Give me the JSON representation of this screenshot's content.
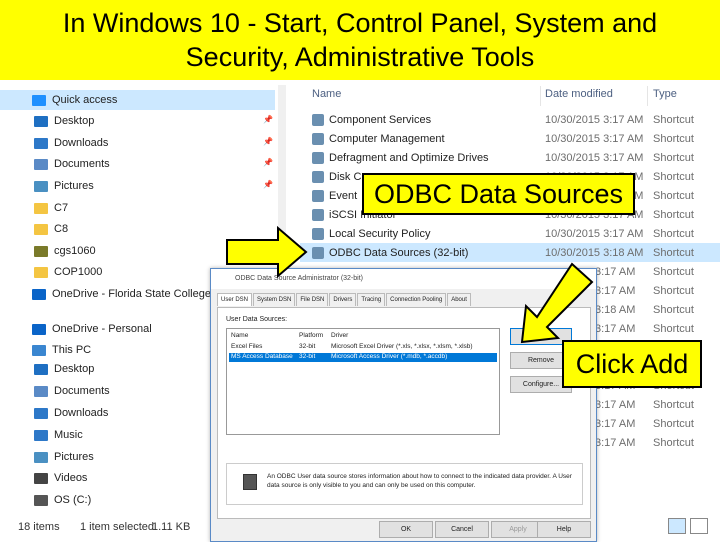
{
  "slide": {
    "title_line1": "In Windows 10 - Start, Control Panel, System and",
    "title_line2": "Security, Administrative Tools"
  },
  "explorer": {
    "nav": [
      {
        "label": "Quick access",
        "icon": "star-icon",
        "color": "#1e90ff"
      },
      {
        "label": "Desktop",
        "icon": "desktop-icon",
        "color": "#1e6fc2",
        "pinned": true
      },
      {
        "label": "Downloads",
        "icon": "download-icon",
        "color": "#2d78c8",
        "pinned": true
      },
      {
        "label": "Documents",
        "icon": "documents-icon",
        "color": "#5a8ac6",
        "pinned": true
      },
      {
        "label": "Pictures",
        "icon": "pictures-icon",
        "color": "#4a90c2",
        "pinned": true
      },
      {
        "label": "C7",
        "icon": "folder-icon",
        "color": "#f4c542"
      },
      {
        "label": "C8",
        "icon": "folder-icon",
        "color": "#f4c542"
      },
      {
        "label": "cgs1060",
        "icon": "folder-icon",
        "color": "#7a7a2a"
      },
      {
        "label": "COP1000",
        "icon": "folder-icon",
        "color": "#f4c542"
      },
      {
        "label": "OneDrive - Florida State College at",
        "icon": "cloud-icon",
        "color": "#0a64c8"
      },
      {
        "label": "OneDrive - Personal",
        "icon": "cloud-icon",
        "color": "#0a64c8"
      },
      {
        "label": "This PC",
        "icon": "computer-icon",
        "color": "#3a86d0"
      },
      {
        "label": "Desktop",
        "icon": "desktop-icon",
        "color": "#1e6fc2"
      },
      {
        "label": "Documents",
        "icon": "documents-icon",
        "color": "#5a8ac6"
      },
      {
        "label": "Downloads",
        "icon": "download-icon",
        "color": "#2d78c8"
      },
      {
        "label": "Music",
        "icon": "music-icon",
        "color": "#2d78c8"
      },
      {
        "label": "Pictures",
        "icon": "pictures-icon",
        "color": "#4a90c2"
      },
      {
        "label": "Videos",
        "icon": "videos-icon",
        "color": "#444444"
      },
      {
        "label": "OS (C:)",
        "icon": "drive-icon",
        "color": "#555555"
      }
    ],
    "columns": {
      "name": "Name",
      "date": "Date modified",
      "type": "Type"
    },
    "files": [
      {
        "name": "Component Services",
        "date": "10/30/2015 3:17 AM",
        "type": "Shortcut"
      },
      {
        "name": "Computer Management",
        "date": "10/30/2015 3:17 AM",
        "type": "Shortcut"
      },
      {
        "name": "Defragment and Optimize Drives",
        "date": "10/30/2015 3:17 AM",
        "type": "Shortcut"
      },
      {
        "name": "Disk C",
        "date": "10/30/2015 3:17 AM",
        "type": "Shortcut"
      },
      {
        "name": "Event",
        "date": "10/30/2015 3:17 AM",
        "type": "Shortcut"
      },
      {
        "name": "iSCSI Initiator",
        "date": "10/30/2015 3:17 AM",
        "type": "Shortcut"
      },
      {
        "name": "Local Security Policy",
        "date": "10/30/2015 3:17 AM",
        "type": "Shortcut"
      },
      {
        "name": "ODBC Data Sources (32-bit)",
        "date": "10/30/2015 3:18 AM",
        "type": "Shortcut"
      },
      {
        "name": "",
        "date": "3:17 AM",
        "type": "Shortcut"
      },
      {
        "name": "",
        "date": "3:17 AM",
        "type": "Shortcut"
      },
      {
        "name": "",
        "date": "3:18 AM",
        "type": "Shortcut"
      },
      {
        "name": "",
        "date": "3:17 AM",
        "type": "Shortcut"
      },
      {
        "name": "",
        "date": "3:17 AM",
        "type": "Shortcut"
      },
      {
        "name": "",
        "date": "3:17 AM",
        "type": "Shortcut"
      },
      {
        "name": "",
        "date": "3:17 AM",
        "type": "Shortcut"
      },
      {
        "name": "",
        "date": "3:17 AM",
        "type": "Shortcut"
      },
      {
        "name": "",
        "date": "3:17 AM",
        "type": "Shortcut"
      },
      {
        "name": "",
        "date": "3:17 AM",
        "type": "Shortcut"
      }
    ],
    "status": {
      "count": "18 items",
      "selected": "1 item selected",
      "size": "1.11 KB"
    }
  },
  "dialog": {
    "title": "ODBC Data Source Administrator (32-bit)",
    "tabs": [
      "User DSN",
      "System DSN",
      "File DSN",
      "Drivers",
      "Tracing",
      "Connection Pooling",
      "About"
    ],
    "list_label": "User Data Sources:",
    "list_headers": {
      "name": "Name",
      "platform": "Platform",
      "driver": "Driver"
    },
    "rows": [
      {
        "name": "Excel Files",
        "platform": "32-bit",
        "driver": "Microsoft Excel Driver (*.xls, *.xlsx, *.xlsm, *.xlsb)"
      },
      {
        "name": "MS Access Database",
        "platform": "32-bit",
        "driver": "Microsoft Access Driver (*.mdb, *.accdb)"
      }
    ],
    "side_buttons": {
      "add": "Add",
      "remove": "Remove",
      "configure": "Configure..."
    },
    "info": "An ODBC User data source stores information about how to connect to the indicated data provider. A User data source is only visible to you and can only be used on this computer.",
    "buttons": {
      "ok": "OK",
      "cancel": "Cancel",
      "apply": "Apply",
      "help": "Help"
    }
  },
  "callouts": {
    "odbc": "ODBC Data Sources",
    "add": "Click Add"
  },
  "colors": {
    "highlight": "#ffff00",
    "selection": "#cce8ff",
    "accent": "#0078d7"
  }
}
